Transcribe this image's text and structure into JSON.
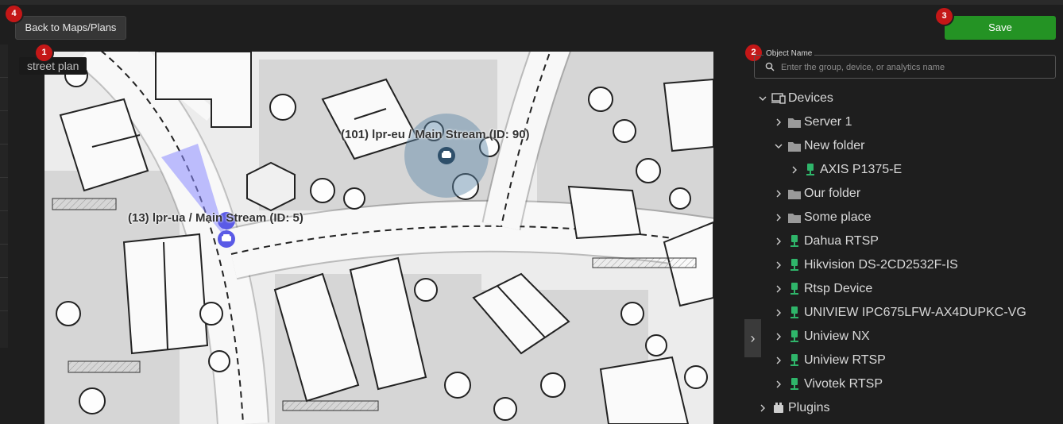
{
  "toolbar": {
    "back_label": "Back to Maps/Plans",
    "save_label": "Save"
  },
  "badges": [
    "1",
    "2",
    "3",
    "4"
  ],
  "map": {
    "name": "street plan",
    "cameras": [
      {
        "label": "(101) lpr-eu / Main Stream (ID: 90)",
        "icon": "car-icon",
        "color": "#2e4f6a"
      },
      {
        "label": "(13) lpr-ua / Main Stream (ID: 5)",
        "icon": "car-icon",
        "color": "#5a5ae6"
      }
    ]
  },
  "search": {
    "legend": "Object Name",
    "placeholder": "Enter the group, device, or analytics name"
  },
  "tree": {
    "devices_label": "Devices",
    "items": [
      {
        "label": "Server 1",
        "icon": "folder-icon"
      },
      {
        "label": "New folder",
        "icon": "folder-icon"
      },
      {
        "label": "AXIS P1375-E",
        "icon": "camera-icon"
      },
      {
        "label": "Our folder",
        "icon": "folder-icon"
      },
      {
        "label": "Some place",
        "icon": "folder-icon"
      },
      {
        "label": "Dahua RTSP",
        "icon": "camera-icon"
      },
      {
        "label": "Hikvision DS-2CD2532F-IS",
        "icon": "camera-icon"
      },
      {
        "label": "Rtsp Device",
        "icon": "camera-icon"
      },
      {
        "label": "UNIVIEW IPC675LFW-AX4DUPKC-VG",
        "icon": "camera-icon"
      },
      {
        "label": "Uniview NX",
        "icon": "camera-icon"
      },
      {
        "label": "Uniview RTSP",
        "icon": "camera-icon"
      },
      {
        "label": "Vivotek RTSP",
        "icon": "camera-icon"
      }
    ],
    "plugins_label": "Plugins"
  },
  "colors": {
    "accent_save": "#249324",
    "badge": "#c41717",
    "camera_online": "#2fb56a"
  }
}
